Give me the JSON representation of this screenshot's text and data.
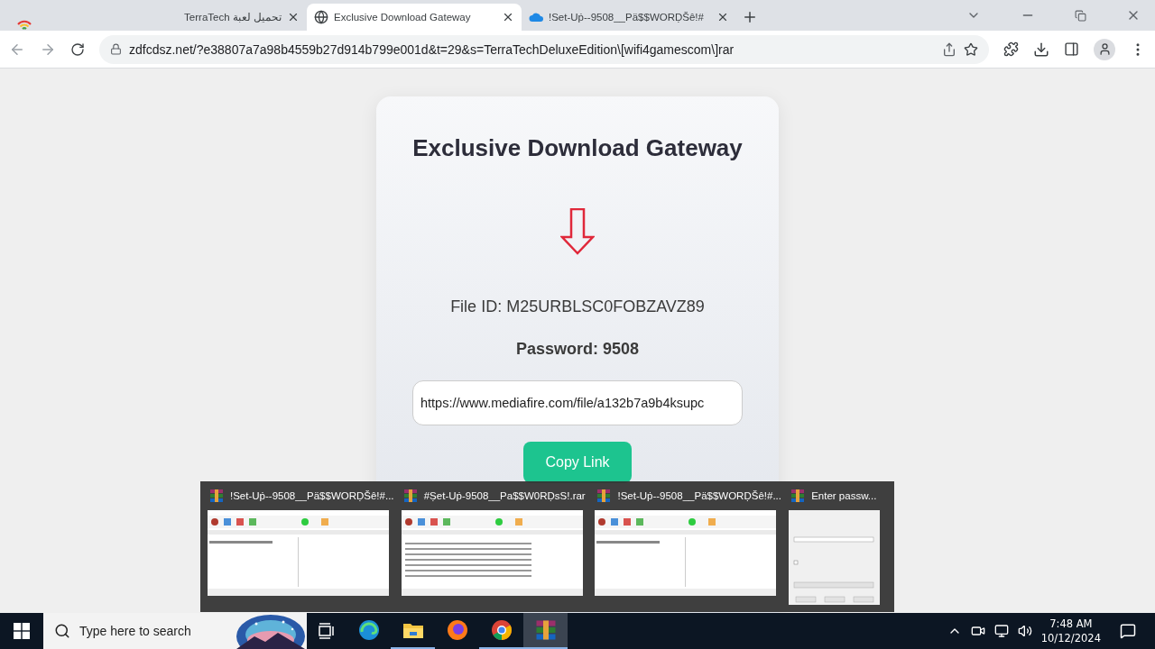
{
  "browser": {
    "tabs": [
      {
        "title": "تحميل لعبة TerraTech",
        "selected": false
      },
      {
        "title": "Exclusive Download Gateway",
        "selected": true
      },
      {
        "title": "!Set-Uṗ--9508__Pä$$WORḌŠȇ!#",
        "selected": false
      }
    ],
    "url": "zdfcdsz.net/?e38807a7a98b4559b27d914b799e001d&t=29&s=TerraTechDeluxeEdition\\[wifi4gamescom\\]rar"
  },
  "page": {
    "title": "Exclusive Download Gateway",
    "file_id": "File ID: M25URBLSC0FOBZAVZ89",
    "password": "Password: 9508",
    "link": "https://www.mediafire.com/file/a132b7a9b4ksupc",
    "button": "Copy Link"
  },
  "previews": [
    {
      "title": "!Set-Uṗ--9508__Pä$$WORḌŠȇ!#...",
      "kind": "archive"
    },
    {
      "title": "#Ṣet-Uṗ-9508__Pa$$W0RḌsS!.rar",
      "kind": "listing"
    },
    {
      "title": "!Set-Uṗ--9508__Pä$$WORḌŠȇ!#...",
      "kind": "archive"
    },
    {
      "title": "Enter passw...",
      "kind": "dialog"
    }
  ],
  "taskbar": {
    "search_placeholder": "Type here to search",
    "apps": [
      {
        "running": false,
        "selected": false
      },
      {
        "running": true,
        "selected": false
      },
      {
        "running": false,
        "selected": false
      },
      {
        "running": true,
        "selected": false
      },
      {
        "running": true,
        "selected": true
      }
    ],
    "time": "7:48 AM",
    "date": "10/12/2024"
  }
}
